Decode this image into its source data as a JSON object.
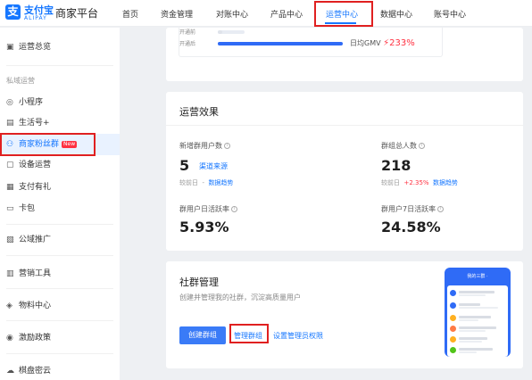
{
  "header": {
    "logo_glyph": "支",
    "brand": "支付宝",
    "brand_sub": "ALIPAY",
    "platform": "商家平台",
    "nav": [
      "首页",
      "资金管理",
      "对账中心",
      "产品中心",
      "运营中心",
      "数据中心",
      "账号中心"
    ],
    "active_nav": "运营中心"
  },
  "sidebar": {
    "items": [
      {
        "icon": "▣",
        "label": "运营总览"
      },
      {
        "icon": "◎",
        "label": "小程序"
      },
      {
        "icon": "▤",
        "label": "生活号+"
      },
      {
        "icon": "⚇",
        "label": "商家粉丝群",
        "badge": "New"
      },
      {
        "icon": "▢",
        "label": "设备运营"
      },
      {
        "icon": "▦",
        "label": "支付有礼"
      },
      {
        "icon": "▭",
        "label": "卡包"
      },
      {
        "icon": "▧",
        "label": "公域推广"
      },
      {
        "icon": "▥",
        "label": "营销工具"
      },
      {
        "icon": "◈",
        "label": "物料中心"
      },
      {
        "icon": "◉",
        "label": "激励政策"
      },
      {
        "icon": "☁",
        "label": "棋盘密云"
      }
    ],
    "section_label": "私域运营"
  },
  "top_card": {
    "row1_label": "开通前",
    "row2_label": "开通后",
    "row1_progress": 0.18,
    "row2_progress": 1.0,
    "gmv_label": "日均GMV",
    "gmv_arrow": "⚡",
    "gmv_value": "233%"
  },
  "metrics": {
    "title": "运营效果",
    "new_users_label": "新增群用户数",
    "new_users_value": "5",
    "new_users_link": "渠道来源",
    "new_users_prev": "较前日",
    "new_users_prev_value": "-",
    "new_users_trend": "数据趋势",
    "total_label": "群组总人数",
    "total_value": "218",
    "total_prev": "较前日",
    "total_change": "+2.35%",
    "total_trend": "数据趋势",
    "daily_active_label": "群用户日活跃率",
    "daily_active_value": "5.93%",
    "weekly_active_label": "群用户7日活跃率",
    "weekly_active_value": "24.58%",
    "info_glyph": "i"
  },
  "community": {
    "title": "社群管理",
    "desc": "创建并管理我的社群，沉淀高质量用户",
    "create_btn": "创建群组",
    "manage_link": "管理群组",
    "admin_link": "设置管理员权限",
    "phone_title": "我的三群 ·"
  }
}
